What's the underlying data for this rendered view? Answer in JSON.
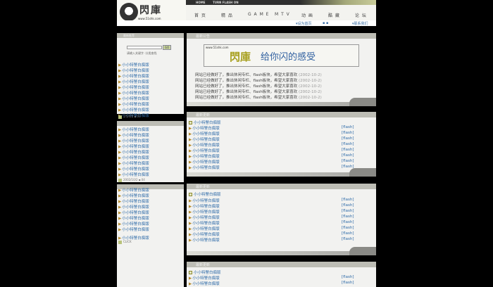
{
  "header": {
    "logo_text": "閃庫",
    "logo_url": "www.51shk.com",
    "topbar": [
      "HOME",
      "TURN FLASH ON"
    ],
    "nav": [
      "首 页",
      "精 品",
      "G A M E",
      "M T V",
      "动 画",
      "酷 藏",
      "论 坛"
    ],
    "subnav": [
      "▾设为首页",
      "▪ ▪",
      "▾联系我们"
    ]
  },
  "left": {
    "panel1": {
      "header": "最新推荐",
      "search_button": "GO",
      "search_text": "请输入关键字 ·分类查找",
      "items": [
        "小小特警白痴版",
        "小小特警白痴版",
        "小小特警白痴版",
        "小小特警白痴版",
        "小小特警白痴版",
        "小小特警白痴版",
        "小小特警白痴版",
        "小小特警白痴版",
        "小小特警白痴版",
        "小小特警白痴版"
      ],
      "footer": "1/5/4/2 ▪ 01"
    },
    "panel2": {
      "items": [
        "小小特警白痴版",
        "小小特警白痴版",
        "小小特警白痴版",
        "小小特警白痴版",
        "小小特警白痴版",
        "小小特警白痴版",
        "小小特警白痴版",
        "小小特警白痴版",
        "小小特警白痴版"
      ],
      "footer": "2002/10/2 ▪ 04"
    },
    "panel3": {
      "items": [
        "小小特警白痴版",
        "小小特警白痴版",
        "小小特警白痴版",
        "小小特警白痴版",
        "小小特警白痴版",
        "小小特警白痴版",
        "小小特警白痴版",
        "小小特警白痴版",
        "小小特警白痴版"
      ],
      "footer": "CLICK"
    }
  },
  "right": {
    "panel1": {
      "header": "最新公告",
      "banner_url": "www.51shk.com",
      "banner_logo": "閃庫",
      "banner_slogan_a": "给你闪的",
      "banner_slogan_b": "感受",
      "news": [
        {
          "text": "网站已经做好了，推出休闲专栏、flash板块，希望大家喜欢",
          "date": "(2002-10-2)"
        },
        {
          "text": "网站已经做好了，推出休闲专栏、flash板块，希望大家喜欢",
          "date": "(2002-10-2)"
        },
        {
          "text": "网站已经做好了，推出休闲专栏、flash板块，希望大家喜欢",
          "date": "(2002-10-2)"
        },
        {
          "text": "网站已经做好了，推出休闲专栏、flash板块，希望大家喜欢",
          "date": "(2002-10-2)"
        },
        {
          "text": "网站已经做好了，推出休闲专栏、flash板块，希望大家喜欢",
          "date": "(2002-10-2)"
        }
      ]
    },
    "panel2": {
      "header": "最新更新",
      "title": "小小特警白痴版",
      "items": [
        "小小特警白痴版",
        "小小特警白痴版",
        "小小特警白痴版",
        "小小特警白痴版",
        "小小特警白痴版",
        "小小特警白痴版",
        "小小特警白痴版",
        "小小特警白痴版"
      ],
      "tag": "[flash]"
    },
    "panel3": {
      "header": "最新更新",
      "title": "小小特警白痴版",
      "items": [
        "小小特警白痴版",
        "小小特警白痴版",
        "小小特警白痴版",
        "小小特警白痴版",
        "小小特警白痴版",
        "小小特警白痴版",
        "小小特警白痴版",
        "小小特警白痴版"
      ],
      "tag": "[flash]"
    },
    "panel4": {
      "header": "最新更新",
      "title": "小小特警白痴版",
      "items": [
        "小小特警白痴版",
        "小小特警白痴版"
      ],
      "tag": "[flash]"
    }
  }
}
